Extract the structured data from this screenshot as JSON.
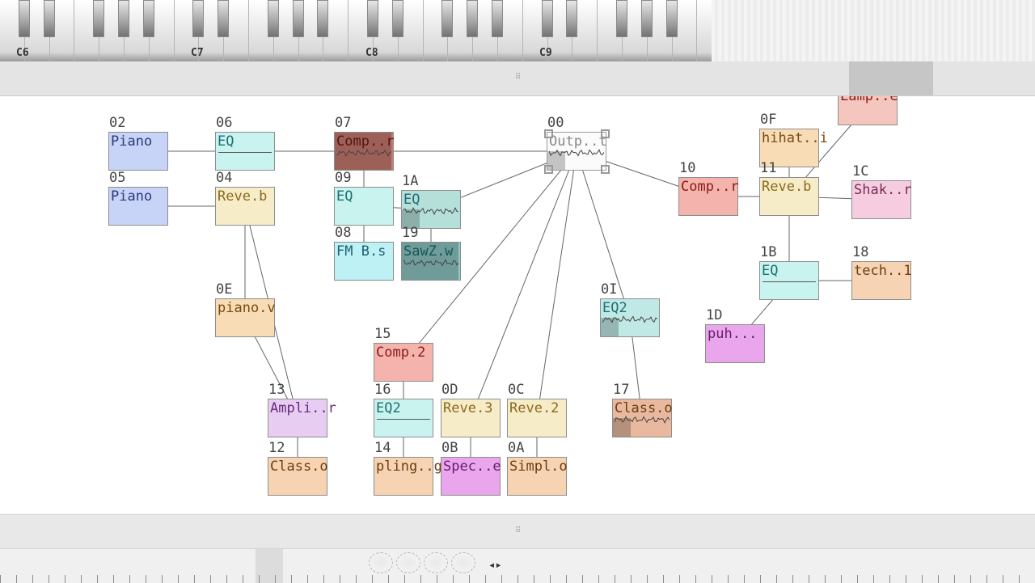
{
  "keyboard": {
    "octave_labels": [
      "C6",
      "C7",
      "C8",
      "C9"
    ]
  },
  "nodes": [
    {
      "id": "02",
      "label": "Piano",
      "color": "#c7d3f7",
      "text": "#2c3a7a"
    },
    {
      "id": "05",
      "label": "Piano",
      "color": "#c7d3f7",
      "text": "#2c3a7a"
    },
    {
      "id": "06",
      "label": "EQ",
      "color": "#c9f3ef",
      "text": "#1d6f73"
    },
    {
      "id": "04",
      "label": "Reve.b",
      "color": "#f7ecc8",
      "text": "#8a6a1e"
    },
    {
      "id": "0E",
      "label": "piano.v",
      "color": "#f7dcb5",
      "text": "#7a4a12"
    },
    {
      "id": "13",
      "label": "Ampli..r",
      "color": "#e8cdf3",
      "text": "#6a2a80"
    },
    {
      "id": "12",
      "label": "Class.o",
      "color": "#f6d3b2",
      "text": "#6e3d12"
    },
    {
      "id": "07",
      "label": "Comp..r",
      "color": "#c97b73",
      "text": "#6d1a14"
    },
    {
      "id": "09",
      "label": "EQ",
      "color": "#c9f3ef",
      "text": "#1d6f73"
    },
    {
      "id": "08",
      "label": "FM B.s",
      "color": "#bdf1f3",
      "text": "#1d5f73"
    },
    {
      "id": "1A",
      "label": "EQ",
      "color": "#b5e0da",
      "text": "#1d6f73"
    },
    {
      "id": "19",
      "label": "SawZ.w",
      "color": "#8fc7c4",
      "text": "#1d6f73"
    },
    {
      "id": "00",
      "label": "Outp..t",
      "color": "#f2f2f2",
      "text": "#888888"
    },
    {
      "id": "15",
      "label": "Comp.2",
      "color": "#f5b3ad",
      "text": "#8a1a14"
    },
    {
      "id": "16",
      "label": "EQ2",
      "color": "#c9f3ef",
      "text": "#1d6f73"
    },
    {
      "id": "14",
      "label": "pling..g",
      "color": "#f6d3b2",
      "text": "#6e3d12"
    },
    {
      "id": "0D",
      "label": "Reve.3",
      "color": "#f7ecc8",
      "text": "#8a6a1e"
    },
    {
      "id": "0B",
      "label": "Spec..e",
      "color": "#e9a6ec",
      "text": "#6a1a70"
    },
    {
      "id": "0C",
      "label": "Reve.2",
      "color": "#f7ecc8",
      "text": "#8a6a1e"
    },
    {
      "id": "0A",
      "label": "Simpl.o",
      "color": "#f6d3b2",
      "text": "#6e3d12"
    },
    {
      "id": "0I",
      "label": "EQ2",
      "color": "#c0e9e6",
      "text": "#1d6f73"
    },
    {
      "id": "17",
      "label": "Class.o",
      "color": "#e8b99e",
      "text": "#6e3d12"
    },
    {
      "id": "10",
      "label": "Comp..r",
      "color": "#f5b3ad",
      "text": "#8a1a14"
    },
    {
      "id": "0F",
      "label": "hihat..i",
      "color": "#f7dcb5",
      "text": "#7a4a12"
    },
    {
      "id": "11",
      "label": "Reve.b",
      "color": "#f7ecc8",
      "text": "#8a6a1e"
    },
    {
      "id": "",
      "label": "Lamp..e",
      "color": "#f5c6bd",
      "text": "#8a1a14"
    },
    {
      "id": "1C",
      "label": "Shak..r",
      "color": "#f6cde0",
      "text": "#7a2a55"
    },
    {
      "id": "1B",
      "label": "EQ",
      "color": "#c9f3ef",
      "text": "#1d6f73"
    },
    {
      "id": "18",
      "label": "tech..1",
      "color": "#f6d3b2",
      "text": "#6e3d12"
    },
    {
      "id": "1D",
      "label": "puh...",
      "color": "#e9a6ec",
      "text": "#6a1a70"
    }
  ]
}
